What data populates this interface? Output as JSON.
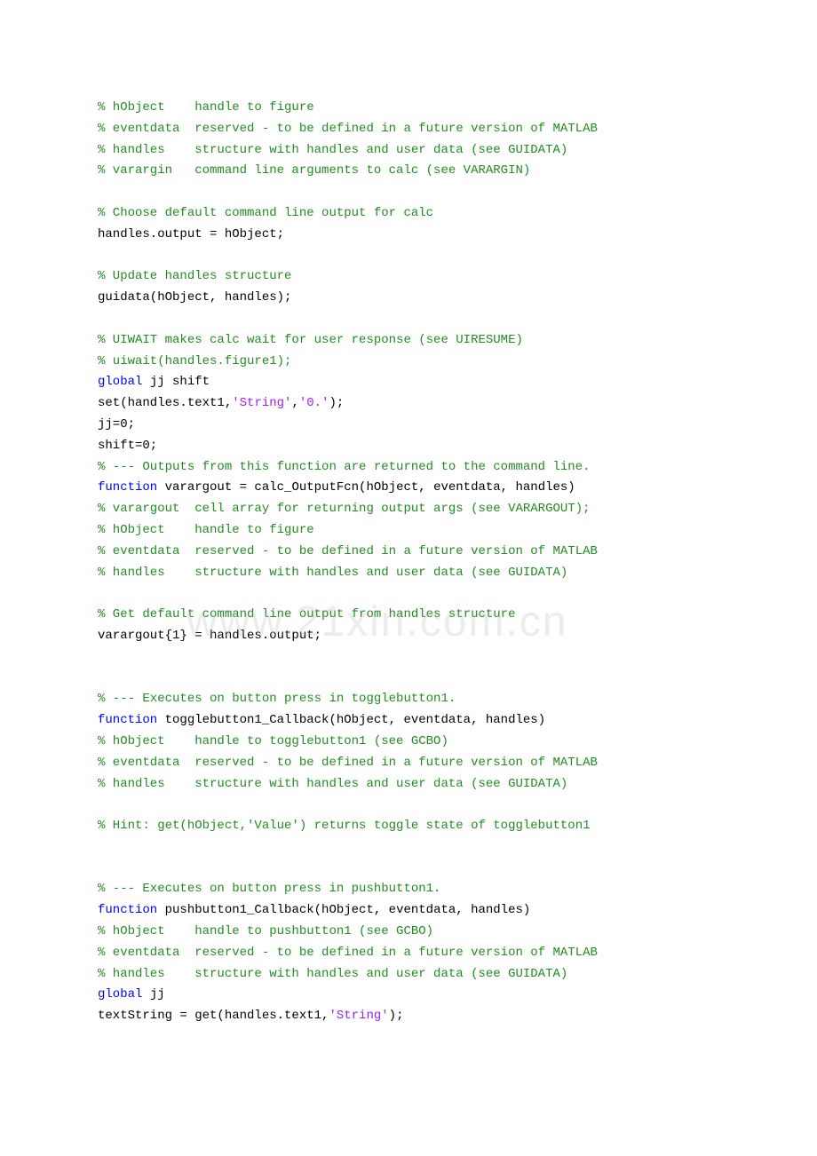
{
  "lines": [
    {
      "segments": [
        {
          "cls": "comment",
          "text": "% hObject    handle to figure"
        }
      ]
    },
    {
      "segments": [
        {
          "cls": "comment",
          "text": "% eventdata  reserved - to be defined in a future version of MATLAB"
        }
      ]
    },
    {
      "segments": [
        {
          "cls": "comment",
          "text": "% handles    structure with handles and user data (see GUIDATA)"
        }
      ]
    },
    {
      "segments": [
        {
          "cls": "comment",
          "text": "% varargin   command line arguments to calc (see VARARGIN)"
        }
      ]
    },
    {
      "segments": [
        {
          "cls": "plain",
          "text": ""
        }
      ]
    },
    {
      "segments": [
        {
          "cls": "comment",
          "text": "% Choose default command line output for calc"
        }
      ]
    },
    {
      "segments": [
        {
          "cls": "plain",
          "text": "handles.output = hObject;"
        }
      ]
    },
    {
      "segments": [
        {
          "cls": "plain",
          "text": ""
        }
      ]
    },
    {
      "segments": [
        {
          "cls": "comment",
          "text": "% Update handles structure"
        }
      ]
    },
    {
      "segments": [
        {
          "cls": "plain",
          "text": "guidata(hObject, handles);"
        }
      ]
    },
    {
      "segments": [
        {
          "cls": "plain",
          "text": ""
        }
      ]
    },
    {
      "segments": [
        {
          "cls": "comment",
          "text": "% UIWAIT makes calc wait for user response (see UIRESUME)"
        }
      ]
    },
    {
      "segments": [
        {
          "cls": "comment",
          "text": "% uiwait(handles.figure1);"
        }
      ]
    },
    {
      "segments": [
        {
          "cls": "keyword",
          "text": "global"
        },
        {
          "cls": "plain",
          "text": " jj shift"
        }
      ]
    },
    {
      "segments": [
        {
          "cls": "plain",
          "text": "set(handles.text1,"
        },
        {
          "cls": "string",
          "text": "'String'"
        },
        {
          "cls": "plain",
          "text": ","
        },
        {
          "cls": "string",
          "text": "'0.'"
        },
        {
          "cls": "plain",
          "text": ");"
        }
      ]
    },
    {
      "segments": [
        {
          "cls": "plain",
          "text": "jj=0;"
        }
      ]
    },
    {
      "segments": [
        {
          "cls": "plain",
          "text": "shift=0;"
        }
      ]
    },
    {
      "segments": [
        {
          "cls": "comment",
          "text": "% --- Outputs from this function are returned to the command line."
        }
      ]
    },
    {
      "segments": [
        {
          "cls": "keyword",
          "text": "function"
        },
        {
          "cls": "plain",
          "text": " varargout = calc_OutputFcn(hObject, eventdata, handles) "
        }
      ]
    },
    {
      "segments": [
        {
          "cls": "comment",
          "text": "% varargout  cell array for returning output args (see VARARGOUT);"
        }
      ]
    },
    {
      "segments": [
        {
          "cls": "comment",
          "text": "% hObject    handle to figure"
        }
      ]
    },
    {
      "segments": [
        {
          "cls": "comment",
          "text": "% eventdata  reserved - to be defined in a future version of MATLAB"
        }
      ]
    },
    {
      "segments": [
        {
          "cls": "comment",
          "text": "% handles    structure with handles and user data (see GUIDATA)"
        }
      ]
    },
    {
      "segments": [
        {
          "cls": "plain",
          "text": ""
        }
      ]
    },
    {
      "segments": [
        {
          "cls": "comment",
          "text": "% Get default command line output from handles structure"
        }
      ]
    },
    {
      "segments": [
        {
          "cls": "plain",
          "text": "varargout{1} = handles.output;"
        }
      ]
    },
    {
      "segments": [
        {
          "cls": "plain",
          "text": ""
        }
      ]
    },
    {
      "segments": [
        {
          "cls": "plain",
          "text": ""
        }
      ]
    },
    {
      "segments": [
        {
          "cls": "comment",
          "text": "% --- Executes on button press in togglebutton1."
        }
      ]
    },
    {
      "segments": [
        {
          "cls": "keyword",
          "text": "function"
        },
        {
          "cls": "plain",
          "text": " togglebutton1_Callback(hObject, eventdata, handles)"
        }
      ]
    },
    {
      "segments": [
        {
          "cls": "comment",
          "text": "% hObject    handle to togglebutton1 (see GCBO)"
        }
      ]
    },
    {
      "segments": [
        {
          "cls": "comment",
          "text": "% eventdata  reserved - to be defined in a future version of MATLAB"
        }
      ]
    },
    {
      "segments": [
        {
          "cls": "comment",
          "text": "% handles    structure with handles and user data (see GUIDATA)"
        }
      ]
    },
    {
      "segments": [
        {
          "cls": "plain",
          "text": ""
        }
      ]
    },
    {
      "segments": [
        {
          "cls": "comment",
          "text": "% Hint: get(hObject,'Value') returns toggle state of togglebutton1"
        }
      ]
    },
    {
      "segments": [
        {
          "cls": "plain",
          "text": ""
        }
      ]
    },
    {
      "segments": [
        {
          "cls": "plain",
          "text": ""
        }
      ]
    },
    {
      "segments": [
        {
          "cls": "comment",
          "text": "% --- Executes on button press in pushbutton1."
        }
      ]
    },
    {
      "segments": [
        {
          "cls": "keyword",
          "text": "function"
        },
        {
          "cls": "plain",
          "text": " pushbutton1_Callback(hObject, eventdata, handles)"
        }
      ]
    },
    {
      "segments": [
        {
          "cls": "comment",
          "text": "% hObject    handle to pushbutton1 (see GCBO)"
        }
      ]
    },
    {
      "segments": [
        {
          "cls": "comment",
          "text": "% eventdata  reserved - to be defined in a future version of MATLAB"
        }
      ]
    },
    {
      "segments": [
        {
          "cls": "comment",
          "text": "% handles    structure with handles and user data (see GUIDATA)"
        }
      ]
    },
    {
      "segments": [
        {
          "cls": "keyword",
          "text": "global"
        },
        {
          "cls": "plain",
          "text": " jj"
        }
      ]
    },
    {
      "segments": [
        {
          "cls": "plain",
          "text": "textString = get(handles.text1,"
        },
        {
          "cls": "string",
          "text": "'String'"
        },
        {
          "cls": "plain",
          "text": ");"
        }
      ]
    }
  ],
  "watermark": "www.21xin.com.cn"
}
